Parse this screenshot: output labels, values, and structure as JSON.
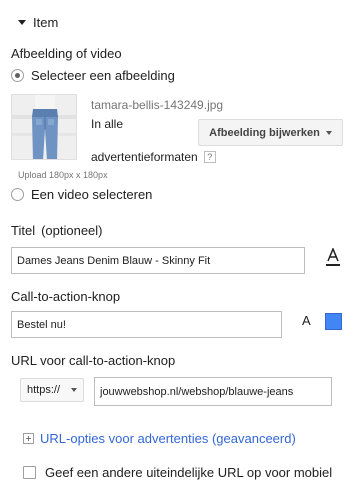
{
  "section": {
    "title": "Item"
  },
  "image_or_video": {
    "label": "Afbeelding of video",
    "select_image_label": "Selecteer een afbeelding",
    "filename": "tamara-bellis-143249.jpg",
    "formats_line1": "In alle",
    "formats_line2": "advertentieformaten",
    "help_glyph": "?",
    "update_button_label": "Afbeelding bijwerken",
    "upload_hint": "Upload 180px x 180px",
    "select_video_label": "Een video selecteren"
  },
  "title_field": {
    "label": "Titel",
    "optional": "(optioneel)",
    "value": "Dames Jeans Denim Blauw - Skinny Fit"
  },
  "cta_field": {
    "label": "Call-to-action-knop",
    "value": "Bestel nu!",
    "text_color_glyph": "A",
    "swatch_color": "#4285f4"
  },
  "url_field": {
    "label": "URL voor call-to-action-knop",
    "protocol": "https://",
    "value": "jouwwebshop.nl/webshop/blauwe-jeans"
  },
  "advanced": {
    "link_label": "URL-opties voor advertenties (geavanceerd)"
  },
  "mobile": {
    "checkbox_label": "Geef een andere uiteindelijke URL op voor mobiel"
  }
}
